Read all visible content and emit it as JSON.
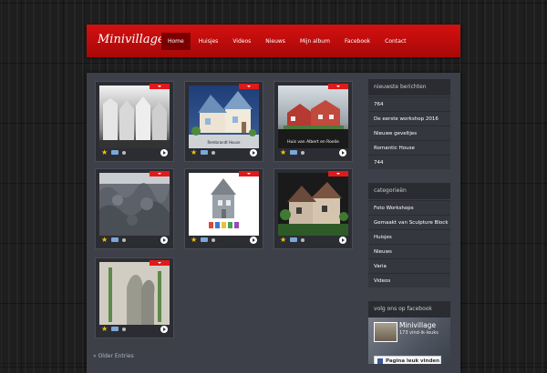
{
  "site": {
    "logo": "Minivillage"
  },
  "nav": {
    "items": [
      {
        "label": "Home",
        "active": true
      },
      {
        "label": "Huisjes",
        "active": false
      },
      {
        "label": "Videos",
        "active": false
      },
      {
        "label": "Nieuws",
        "active": false
      },
      {
        "label": "Mijn album",
        "active": false
      },
      {
        "label": "Facebook",
        "active": false
      },
      {
        "label": "Contact",
        "active": false
      }
    ]
  },
  "posts": [
    {
      "caption": ""
    },
    {
      "caption": "Rembrandt House"
    },
    {
      "caption": "Huis van Albert en Roelie"
    },
    {
      "caption": ""
    },
    {
      "caption": ""
    },
    {
      "caption": ""
    },
    {
      "caption": ""
    }
  ],
  "pagination": {
    "older": "« Older Entries"
  },
  "sidebar": {
    "recent": {
      "title": "nieuwste berichten",
      "items": [
        "764",
        "De eerste workshop 2016",
        "Nieuwe geveltjes",
        "Romantic House",
        "744"
      ]
    },
    "categories": {
      "title": "categorieën",
      "items": [
        "Foto Workshops",
        "Gemaakt van Sculpture Block",
        "Huisjes",
        "Nieuws",
        "Varia",
        "Videos"
      ]
    },
    "facebook": {
      "title": "volg ons op facebook",
      "page_name": "Minivillage",
      "likes": "173 vind-ik-leuks",
      "like_button": "Pagina leuk vinden"
    }
  },
  "colors": {
    "brand_red": "#c40c0c",
    "active_nav": "#7a0000",
    "panel": "#3d4048"
  },
  "icons": [
    "star-icon",
    "comment-icon",
    "more-arrow-icon",
    "facebook-icon"
  ]
}
